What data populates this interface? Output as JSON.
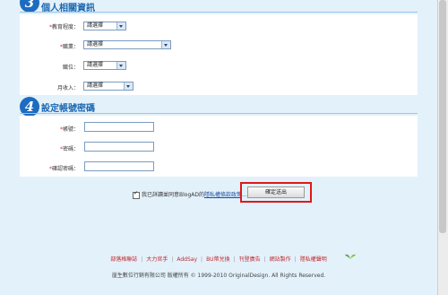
{
  "section3": {
    "number": "3",
    "title": "個人相關資訊"
  },
  "section4": {
    "number": "4",
    "title": "設定帳號密碼"
  },
  "personal": {
    "education": {
      "label": "教育程度：",
      "value": "請選擇"
    },
    "occupation": {
      "label": "職業：",
      "value": "請選擇"
    },
    "position": {
      "label": "職位：",
      "value": "請選擇"
    },
    "income": {
      "label": "月收入：",
      "value": "請選擇"
    }
  },
  "account": {
    "username_label": "帳號：",
    "password_label": "密碼：",
    "confirm_label": "確認密碼："
  },
  "required_mark": "*",
  "agree": {
    "prefix": "我已詳讀並同意BlogAD的",
    "link": "隱私權條款政策",
    "suffix": "…"
  },
  "submit_label": "確定送出",
  "footer": {
    "links": [
      "部落格聯誌",
      "大力官手",
      "AddSay",
      "BU幣兌換",
      "刊登廣告",
      "網站製作",
      "隱私權聲明"
    ],
    "copyright": "崖生數位行銷有限公司 版權所有 © 1999-2010 OriginalDesign. All Rights Reserved."
  },
  "colors": {
    "accent": "#1b67b0",
    "highlight": "#e01818",
    "footer_link": "#c2272d",
    "page_bg": "#e3f1fb"
  }
}
